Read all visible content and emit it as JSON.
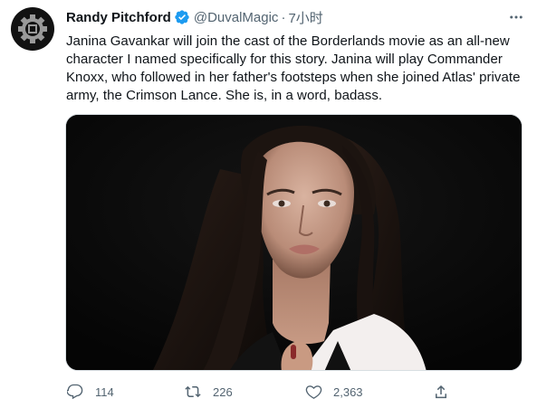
{
  "author": {
    "name": "Randy Pitchford",
    "handle": "@DuvalMagic",
    "separator": "·",
    "time": "7小时"
  },
  "tweet": {
    "text_lines": [
      "Janina Gavankar will join the cast of the Borderlands movie as an all-new",
      "character I named specifically for this story. Janina will play Commander",
      "Knoxx, who followed in her father's footsteps when she joined Atlas' private",
      "army, the Crimson Lance. She is, in a word, badass."
    ]
  },
  "actions": {
    "reply_count": "114",
    "retweet_count": "226",
    "like_count": "2,363"
  },
  "icons": {
    "avatar": "gear-icon",
    "verified": "verified-badge-icon",
    "more": "more-icon",
    "reply": "reply-icon",
    "retweet": "retweet-icon",
    "like": "heart-icon",
    "share": "share-icon"
  },
  "colors": {
    "verified_blue": "#1d9bf0",
    "secondary_text": "#536471",
    "primary_text": "#0f1419"
  }
}
